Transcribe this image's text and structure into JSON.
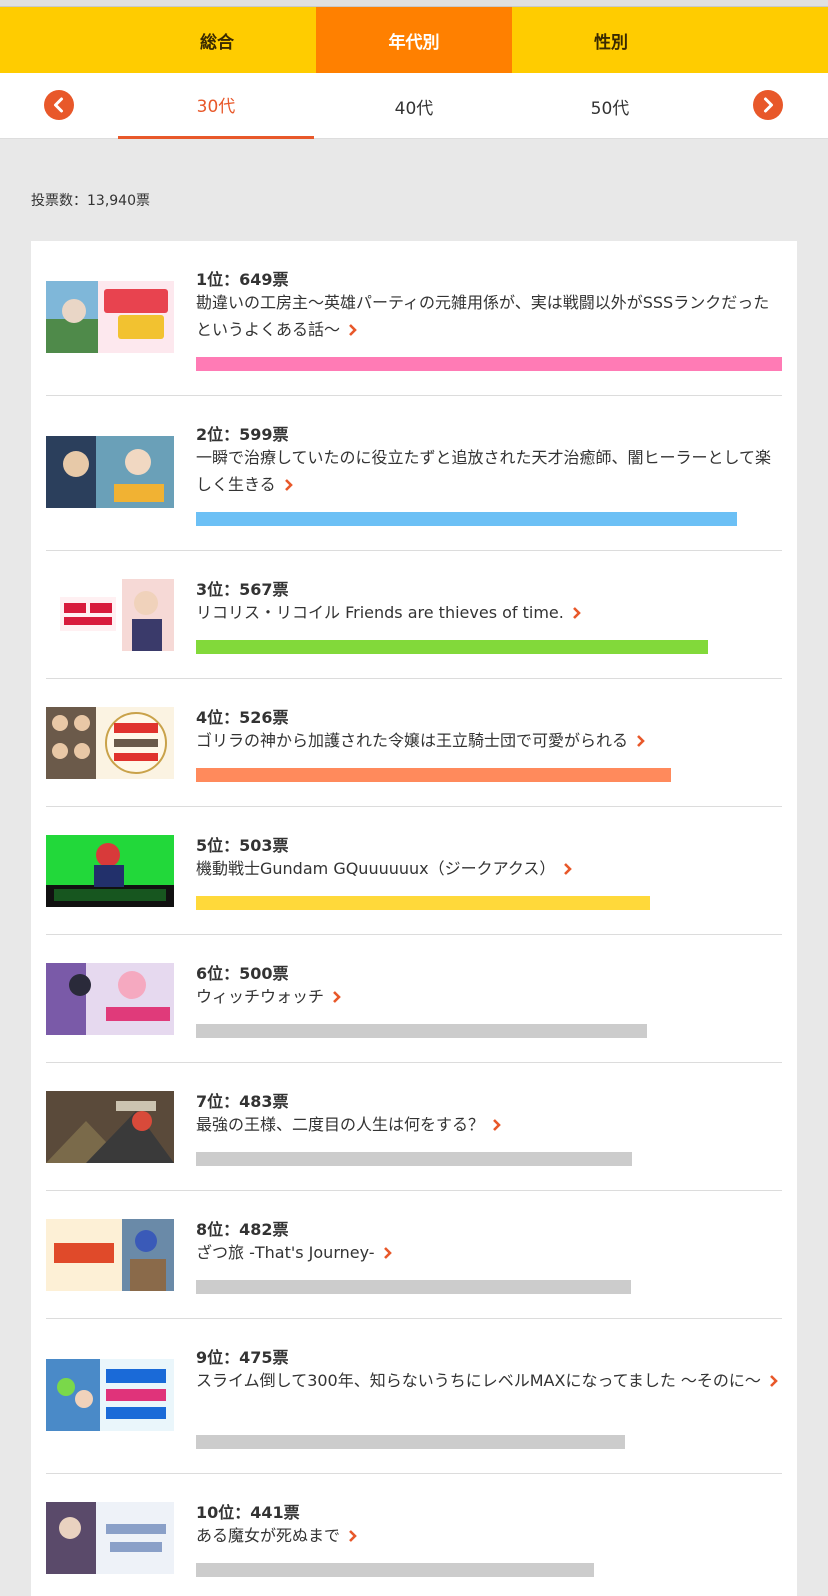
{
  "tabs": {
    "overall": "総合",
    "by_age": "年代別",
    "by_gender": "性別"
  },
  "ages": [
    "30代",
    "40代",
    "50代"
  ],
  "vote_count": "投票数：13,940票",
  "accent_color": "#e8582a",
  "ranking": [
    {
      "rank_text": "1位：649票",
      "title": "勘違いの工房主〜英雄パーティの元雑用係が、実は戦闘以外がSSSランクだったというよくある話〜",
      "votes": 649,
      "bar_color": "#ff7bb5"
    },
    {
      "rank_text": "2位：599票",
      "title": "一瞬で治療していたのに役立たずと追放された天才治癒師、闇ヒーラーとして楽しく生きる",
      "votes": 599,
      "bar_color": "#6cc0f5"
    },
    {
      "rank_text": "3位：567票",
      "title": "リコリス・リコイル Friends are thieves of time.",
      "votes": 567,
      "bar_color": "#82d93a"
    },
    {
      "rank_text": "4位：526票",
      "title": "ゴリラの神から加護された令嬢は王立騎士団で可愛がられる",
      "votes": 526,
      "bar_color": "#ff8a5c"
    },
    {
      "rank_text": "5位：503票",
      "title": "機動戦士Gundam GQuuuuuux（ジークアクス）",
      "votes": 503,
      "bar_color": "#ffd93a"
    },
    {
      "rank_text": "6位：500票",
      "title": "ウィッチウォッチ",
      "votes": 500,
      "bar_color": "#cccccc"
    },
    {
      "rank_text": "7位：483票",
      "title": "最強の王様、二度目の人生は何をする？",
      "votes": 483,
      "bar_color": "#cccccc"
    },
    {
      "rank_text": "8位：482票",
      "title": "ざつ旅 -That's Journey-",
      "votes": 482,
      "bar_color": "#cccccc"
    },
    {
      "rank_text": "9位：475票",
      "title": "スライム倒して300年、知らないうちにレベルMAXになってました 〜そのに〜",
      "votes": 475,
      "bar_color": "#cccccc"
    },
    {
      "rank_text": "10位：441票",
      "title": "ある魔女が死ぬまで",
      "votes": 441,
      "bar_color": "#cccccc"
    }
  ]
}
